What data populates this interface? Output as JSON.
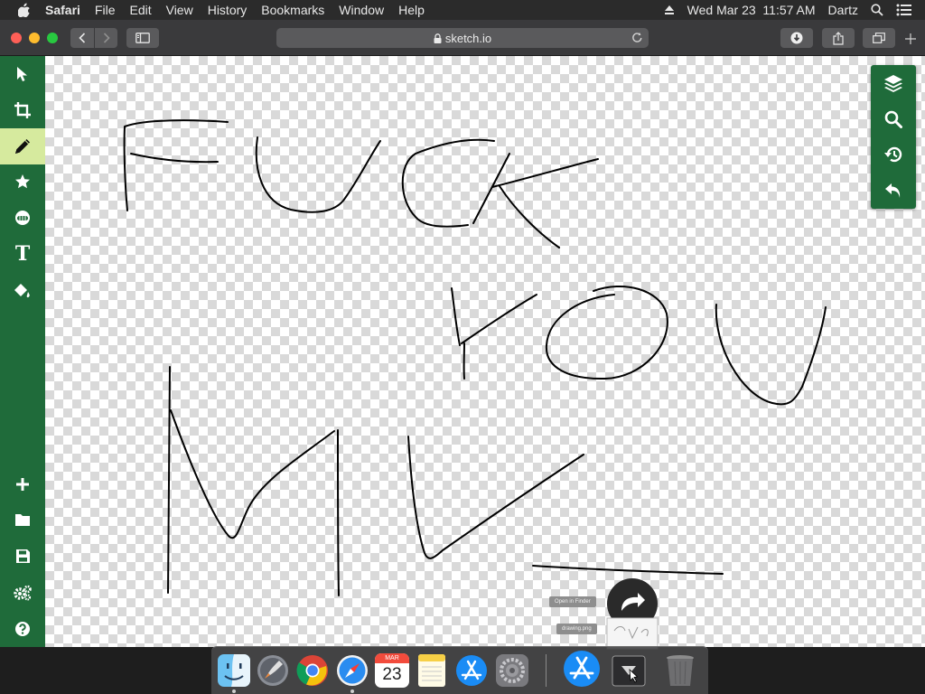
{
  "menubar": {
    "app_name": "Safari",
    "menus": [
      "File",
      "Edit",
      "View",
      "History",
      "Bookmarks",
      "Window",
      "Help"
    ],
    "clock": "Wed Mar 23  11:57 AM",
    "user": "Dartz"
  },
  "browser": {
    "url": "sketch.io"
  },
  "left_tools": [
    {
      "name": "select",
      "icon": "pointer-icon"
    },
    {
      "name": "crop",
      "icon": "crop-icon"
    },
    {
      "name": "pencil",
      "icon": "pencil-icon",
      "active": true
    },
    {
      "name": "stamp",
      "icon": "star-icon"
    },
    {
      "name": "emoji",
      "icon": "face-icon"
    },
    {
      "name": "text",
      "icon": "text-icon",
      "glyph": "T"
    },
    {
      "name": "fill",
      "icon": "paint-bucket-icon"
    },
    {
      "name": "new",
      "icon": "plus-icon"
    },
    {
      "name": "open",
      "icon": "folder-icon"
    },
    {
      "name": "save",
      "icon": "save-icon"
    },
    {
      "name": "settings",
      "icon": "gears-icon"
    },
    {
      "name": "help",
      "icon": "question-icon"
    }
  ],
  "right_tools": [
    {
      "name": "layers",
      "icon": "layers-icon"
    },
    {
      "name": "zoom",
      "icon": "search-icon"
    },
    {
      "name": "history",
      "icon": "history-icon"
    },
    {
      "name": "undo",
      "icon": "undo-icon"
    }
  ],
  "dock": {
    "apps": [
      "Finder",
      "Launchpad",
      "Chrome",
      "Safari",
      "Calendar",
      "Notes",
      "App Store",
      "System Preferences",
      "App Store",
      "Downloads",
      "Trash"
    ],
    "calendar_month": "MAR",
    "calendar_day": "23"
  },
  "screenshot_overlay": {
    "show_in_finder": "Open in Finder",
    "file_name": "drawing.png"
  },
  "colors": {
    "sidebar_green": "#1f6b3a",
    "active_tool": "#d6ea9e",
    "stroke": "#000000"
  }
}
